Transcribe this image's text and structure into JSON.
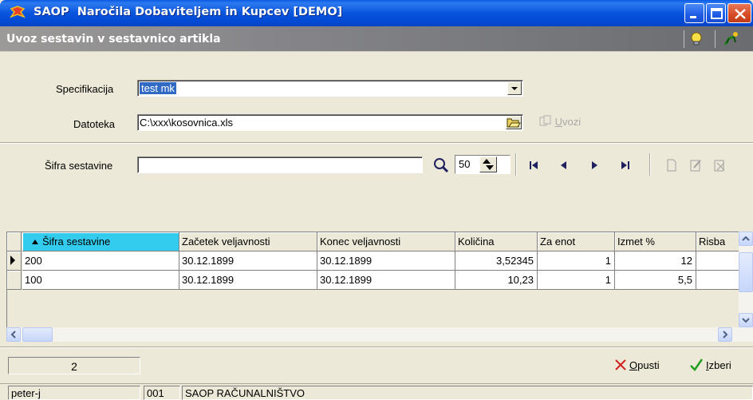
{
  "window": {
    "title": "SAOP  Naročila Dobaviteljem in Kupcev [DEMO]"
  },
  "subheader": {
    "title": "Uvoz sestavin v sestavnico artikla"
  },
  "form": {
    "specifikacija_label": "Specifikacija",
    "specifikacija_value": "test mk",
    "datoteka_label": "Datoteka",
    "datoteka_value": "C:\\xxx\\kosovnica.xls",
    "uvozi_prefix": "",
    "uvozi_u": "U",
    "uvozi_rest": "vozi"
  },
  "search": {
    "label": "Šifra sestavine",
    "value": "",
    "page_size": "50"
  },
  "grid": {
    "columns": [
      "Šifra sestavine",
      "Začetek veljavnosti",
      "Konec veljavnosti",
      "Količina",
      "Za enot",
      "Izmet %",
      "Risba"
    ],
    "rows": [
      [
        "200",
        "30.12.1899",
        "30.12.1899",
        "3,52345",
        "1",
        "12",
        ""
      ],
      [
        "100",
        "30.12.1899",
        "30.12.1899",
        "10,23",
        "1",
        "5,5",
        ""
      ]
    ]
  },
  "footer": {
    "record_count": "2",
    "cancel_u": "O",
    "cancel_rest": "pusti",
    "select_u": "I",
    "select_rest": "zberi"
  },
  "statusbar": {
    "user": "peter-j",
    "code": "001",
    "company": "SAOP RAČUNALNIŠTVO"
  },
  "colors": {
    "titlebar": "#0855dd",
    "sort_header": "#33ccee",
    "selection": "#316ac5"
  }
}
